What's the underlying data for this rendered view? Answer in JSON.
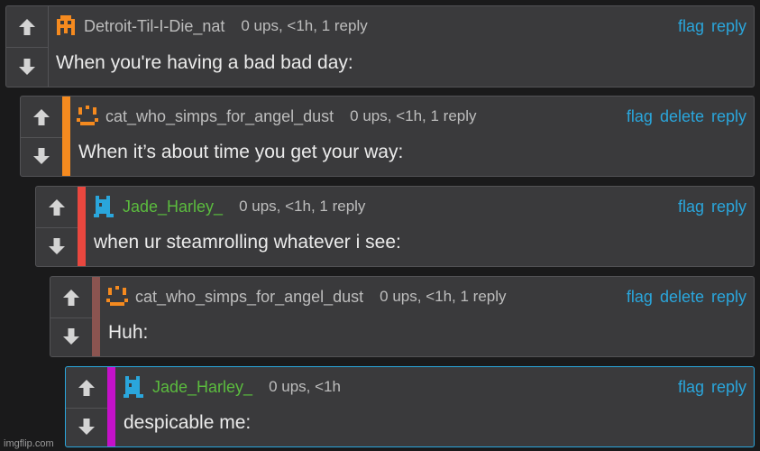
{
  "comments": [
    {
      "user": "Detroit-Til-I-Die_nat",
      "meta": "0 ups, <1h, 1 reply",
      "text": "When you're having a bad bad day:",
      "actions": [
        "flag",
        "reply"
      ],
      "bar_color": "",
      "avatar": "orange-pixel-creature-icon"
    },
    {
      "user": "cat_who_simps_for_angel_dust",
      "meta": "0 ups, <1h, 1 reply",
      "text": "When it’s about time you get your way:",
      "actions": [
        "flag",
        "delete",
        "reply"
      ],
      "bar_color": "#f58a1f",
      "avatar": "orange-smiley-icon"
    },
    {
      "user": "Jade_Harley_",
      "meta": "0 ups, <1h, 1 reply",
      "text": "when ur steamrolling whatever i see:",
      "actions": [
        "flag",
        "reply"
      ],
      "bar_color": "#e9473f",
      "avatar": "blue-pixel-creature-icon"
    },
    {
      "user": "cat_who_simps_for_angel_dust",
      "meta": "0 ups, <1h, 1 reply",
      "text": "Huh:",
      "actions": [
        "flag",
        "delete",
        "reply"
      ],
      "bar_color": "#8b5450",
      "avatar": "orange-smiley-icon"
    },
    {
      "user": "Jade_Harley_",
      "meta": "0 ups, <1h",
      "text": "despicable me:",
      "actions": [
        "flag",
        "reply"
      ],
      "bar_color": "#c511c9",
      "avatar": "blue-pixel-creature-icon"
    }
  ],
  "watermark": "imgflip.com",
  "colors": {
    "link": "#2aa6dc",
    "green_user": "#5bbc3e",
    "selected_border": "#2aa6dc"
  }
}
